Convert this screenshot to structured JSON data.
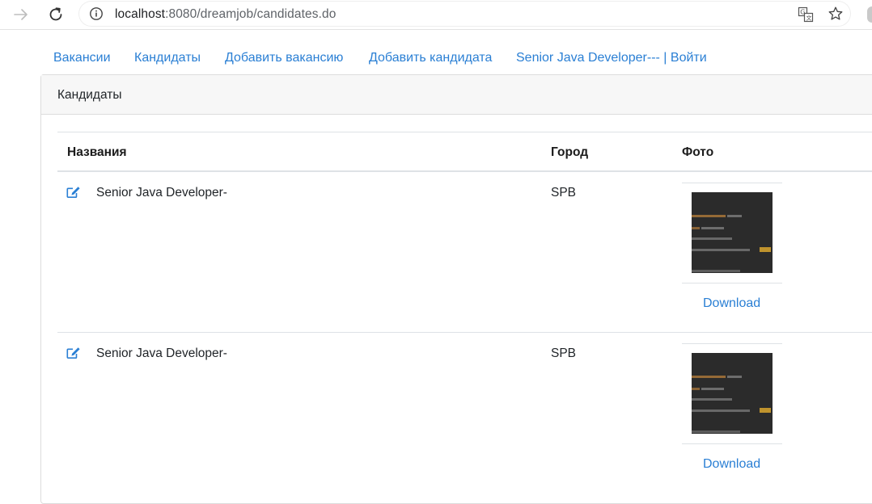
{
  "browser": {
    "url_host": "localhost",
    "url_rest": ":8080/dreamjob/candidates.do"
  },
  "nav": {
    "links": [
      "Вакансии",
      "Кандидаты",
      "Добавить вакансию",
      "Добавить кандидата",
      "Senior Java Developer--- | Войти"
    ]
  },
  "card": {
    "title": "Кандидаты"
  },
  "table": {
    "headers": {
      "name": "Названия",
      "city": "Город",
      "photo": "Фото"
    },
    "rows": [
      {
        "name": "Senior Java Developer-",
        "city": "SPB",
        "download": "Download"
      },
      {
        "name": "Senior Java Developer-",
        "city": "SPB",
        "download": "Download"
      }
    ]
  },
  "colors": {
    "link": "#2a7fd4",
    "header_bg": "#f7f7f7",
    "border": "#dee2e6"
  },
  "icons": [
    "forward-icon",
    "reload-icon",
    "info-icon",
    "translate-icon",
    "star-icon",
    "edit-icon"
  ]
}
